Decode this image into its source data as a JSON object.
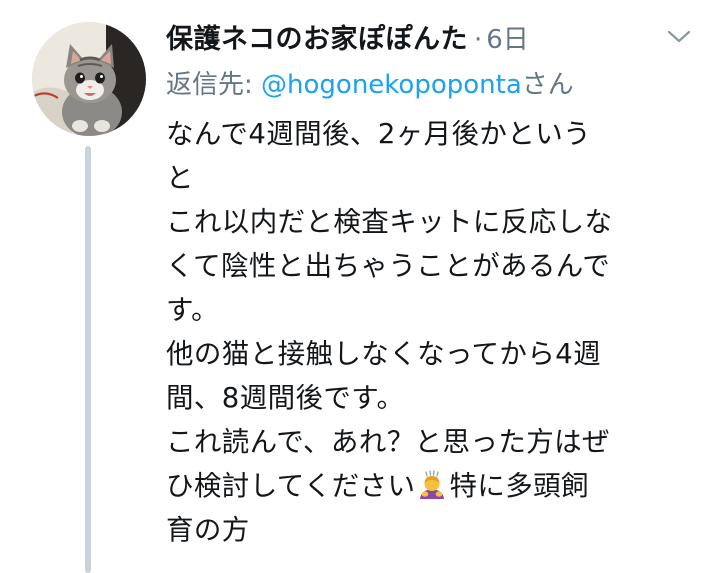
{
  "tweet": {
    "author_name": "保護ネコのお家ぽぽんた",
    "separator": "·",
    "timestamp": "6日",
    "reply_prefix": "返信先: ",
    "reply_handle": "@hogonekopoponta",
    "reply_suffix": "さん",
    "body_lines": [
      "なんで4週間後、2ヶ月後かという",
      "と",
      "これ以内だと検査キットに反応しな",
      "くて陰性と出ちゃうことがあるんで",
      "す。",
      "他の猫と接触しなくなってから4週",
      "間、8週間後です。",
      "これ読んで、あれ？と思った方はぜ",
      "ひ検討してください",
      "特に多頭飼",
      "育の方"
    ],
    "emoji_name": "person-bowing-emoji"
  },
  "icons": {
    "caret": "chevron-down-icon",
    "avatar": "kitten-avatar"
  },
  "colors": {
    "text": "#14171a",
    "secondary": "#657786",
    "link": "#1da1f2",
    "thread_line": "#c8d3db"
  }
}
